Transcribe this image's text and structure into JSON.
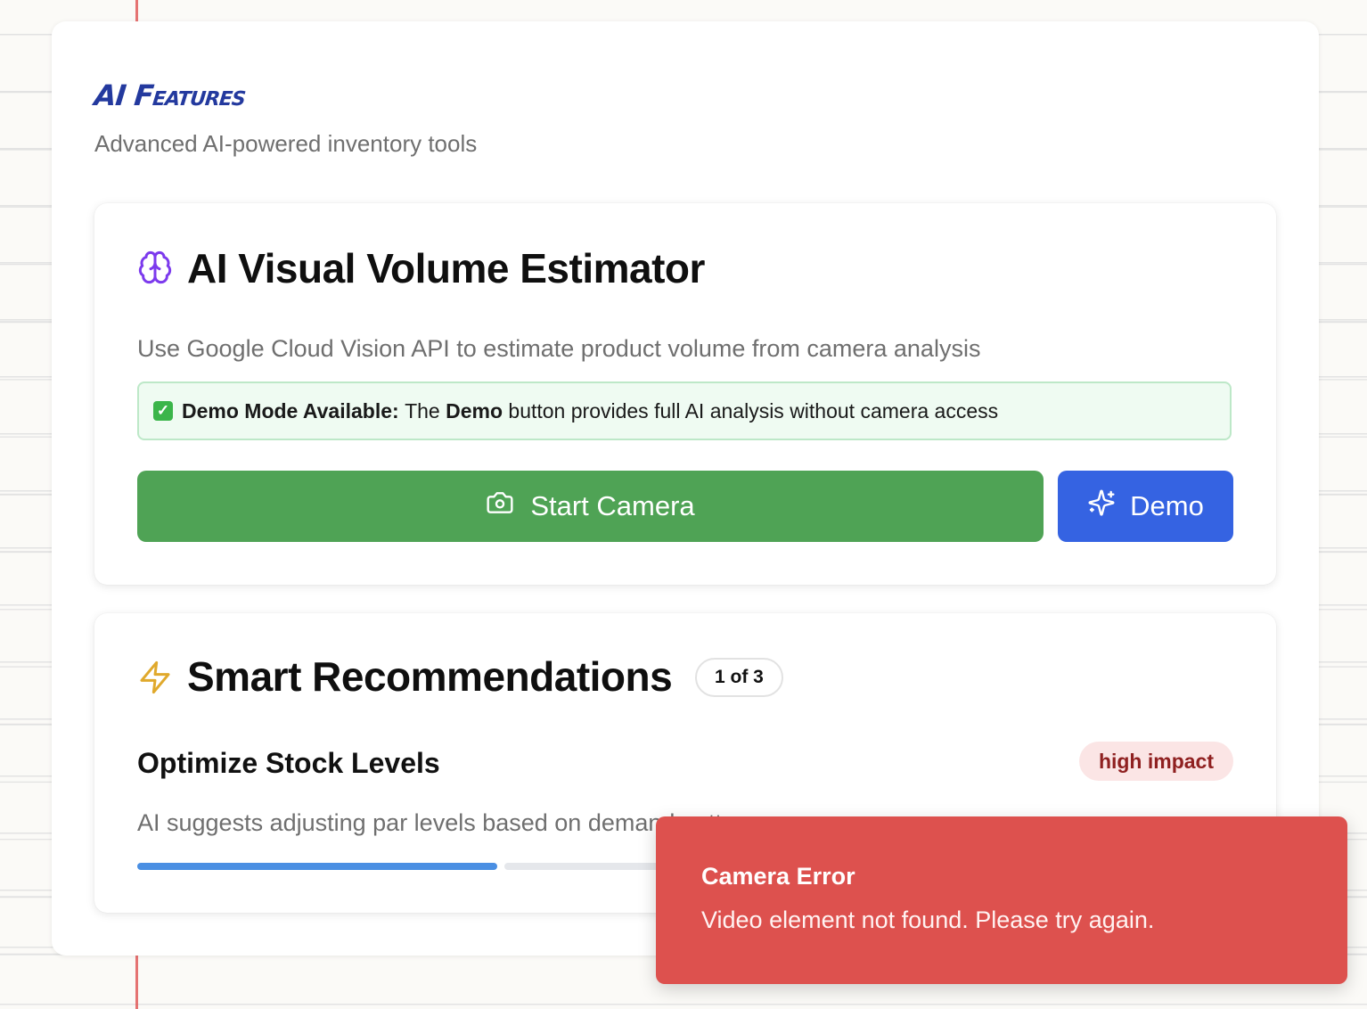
{
  "page": {
    "title": "AI Features",
    "subtitle": "Advanced AI-powered inventory tools"
  },
  "visual_estimator": {
    "icon": "brain-icon",
    "title": "AI Visual Volume Estimator",
    "description": "Use Google Cloud Vision API to estimate product volume from camera analysis",
    "banner": {
      "icon": "check-icon",
      "label": "Demo Mode Available:",
      "text_before": "The",
      "emphasis": "Demo",
      "text_after": "button provides full AI analysis without camera access"
    },
    "start_button": {
      "icon": "camera-icon",
      "label": "Start Camera"
    },
    "demo_button": {
      "icon": "sparkles-icon",
      "label": "Demo"
    }
  },
  "recommendations": {
    "icon": "lightning-icon",
    "title": "Smart Recommendations",
    "counter": "1 of 3",
    "current": {
      "title": "Optimize Stock Levels",
      "impact": "high impact",
      "description": "AI suggests adjusting par levels based on demand patterns"
    },
    "progress": {
      "total": 3,
      "active_index": 0
    }
  },
  "toast": {
    "title": "Camera Error",
    "message": "Video element not found. Please try again."
  },
  "colors": {
    "page_background": "#fbfaf7",
    "margin_line": "#e05a5a",
    "title_blue": "#23399e",
    "start_button": "#4fa355",
    "demo_button": "#3563e2",
    "banner_bg": "#effbf2",
    "impact_bg": "#fbe5e5",
    "impact_text": "#8f2020",
    "progress_active": "#4a8fe3",
    "toast_bg": "#dd514e",
    "brain_icon": "#7c3aed",
    "lightning_icon": "#e0a92c"
  }
}
